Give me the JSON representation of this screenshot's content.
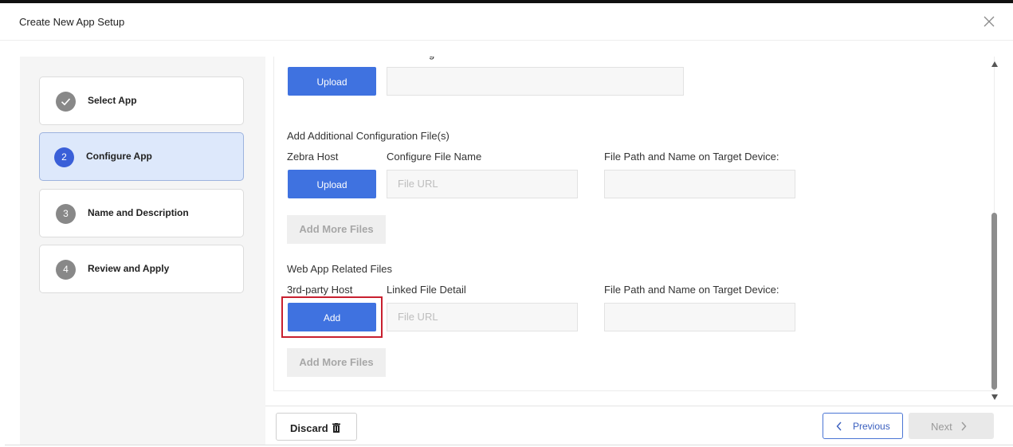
{
  "dialog": {
    "title": "Create New App Setup",
    "close_icon": "close-icon"
  },
  "steps": [
    {
      "number": "",
      "label": "Select App",
      "state": "completed"
    },
    {
      "number": "2",
      "label": "Configure App",
      "state": "active"
    },
    {
      "number": "3",
      "label": "Name and Description",
      "state": "pending"
    },
    {
      "number": "4",
      "label": "Review and Apply",
      "state": "pending"
    }
  ],
  "top_section": {
    "upload_label": "Upload",
    "cut_text": "g"
  },
  "config_files": {
    "heading": "Add Additional Configuration File(s)",
    "col_host": "Zebra Host",
    "col_name": "Configure File Name",
    "col_path": "File Path and Name on Target Device:",
    "upload_label": "Upload",
    "url_placeholder": "File URL",
    "add_more": "Add More Files"
  },
  "web_files": {
    "heading": "Web App Related Files",
    "col_host": "3rd-party Host",
    "col_name": "Linked File Detail",
    "col_path": "File Path and Name on Target Device:",
    "add_label": "Add",
    "url_placeholder": "File URL",
    "add_more": "Add More Files"
  },
  "footer": {
    "discard": "Discard",
    "previous": "Previous",
    "next": "Next"
  },
  "colors": {
    "primary": "#3f72e0",
    "active_step_bg": "#dde8fb",
    "highlight": "#c8202f"
  }
}
